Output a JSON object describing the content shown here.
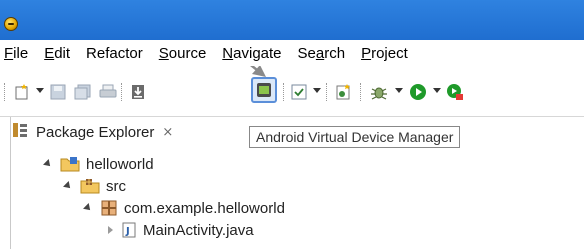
{
  "menu": [
    {
      "label": "File",
      "mnemonic": "F",
      "rest": "ile"
    },
    {
      "label": "Edit",
      "mnemonic": "E",
      "rest": "dit"
    },
    {
      "label": "Refactor",
      "mnemonic": "",
      "rest": "Refactor"
    },
    {
      "label": "Source",
      "mnemonic": "S",
      "rest": "ource"
    },
    {
      "label": "Navigate",
      "mnemonic": "N",
      "rest": "avigate"
    },
    {
      "label": "Search",
      "pre": "Se",
      "mnemonic": "a",
      "rest": "rch"
    },
    {
      "label": "Project",
      "mnemonic": "P",
      "rest": "roject"
    }
  ],
  "toolbar": {
    "highlighted_tooltip": "Android Virtual Device Manager"
  },
  "package_explorer": {
    "tab_label": "Package Explorer",
    "tab_close_glyph": "⨯",
    "tree": [
      {
        "label": "helloworld",
        "kind": "project",
        "expanded": true
      },
      {
        "label": "src",
        "kind": "source-folder",
        "expanded": true
      },
      {
        "label": "com.example.helloworld",
        "kind": "package",
        "expanded": true
      },
      {
        "label": "MainActivity.java",
        "kind": "java-file",
        "expanded": false
      }
    ]
  },
  "colors": {
    "titlebar": "#1f6ed0",
    "highlight_border": "#5b8fd9",
    "run_green": "#1f9a2a"
  },
  "icons": [
    "eclipse-app-icon",
    "new-wizard-icon",
    "save-icon",
    "save-all-icon",
    "print-icon",
    "sdk-manager-icon",
    "avd-manager-icon",
    "task-icon",
    "new-class-icon",
    "debug-icon",
    "run-icon",
    "external-tools-icon"
  ]
}
